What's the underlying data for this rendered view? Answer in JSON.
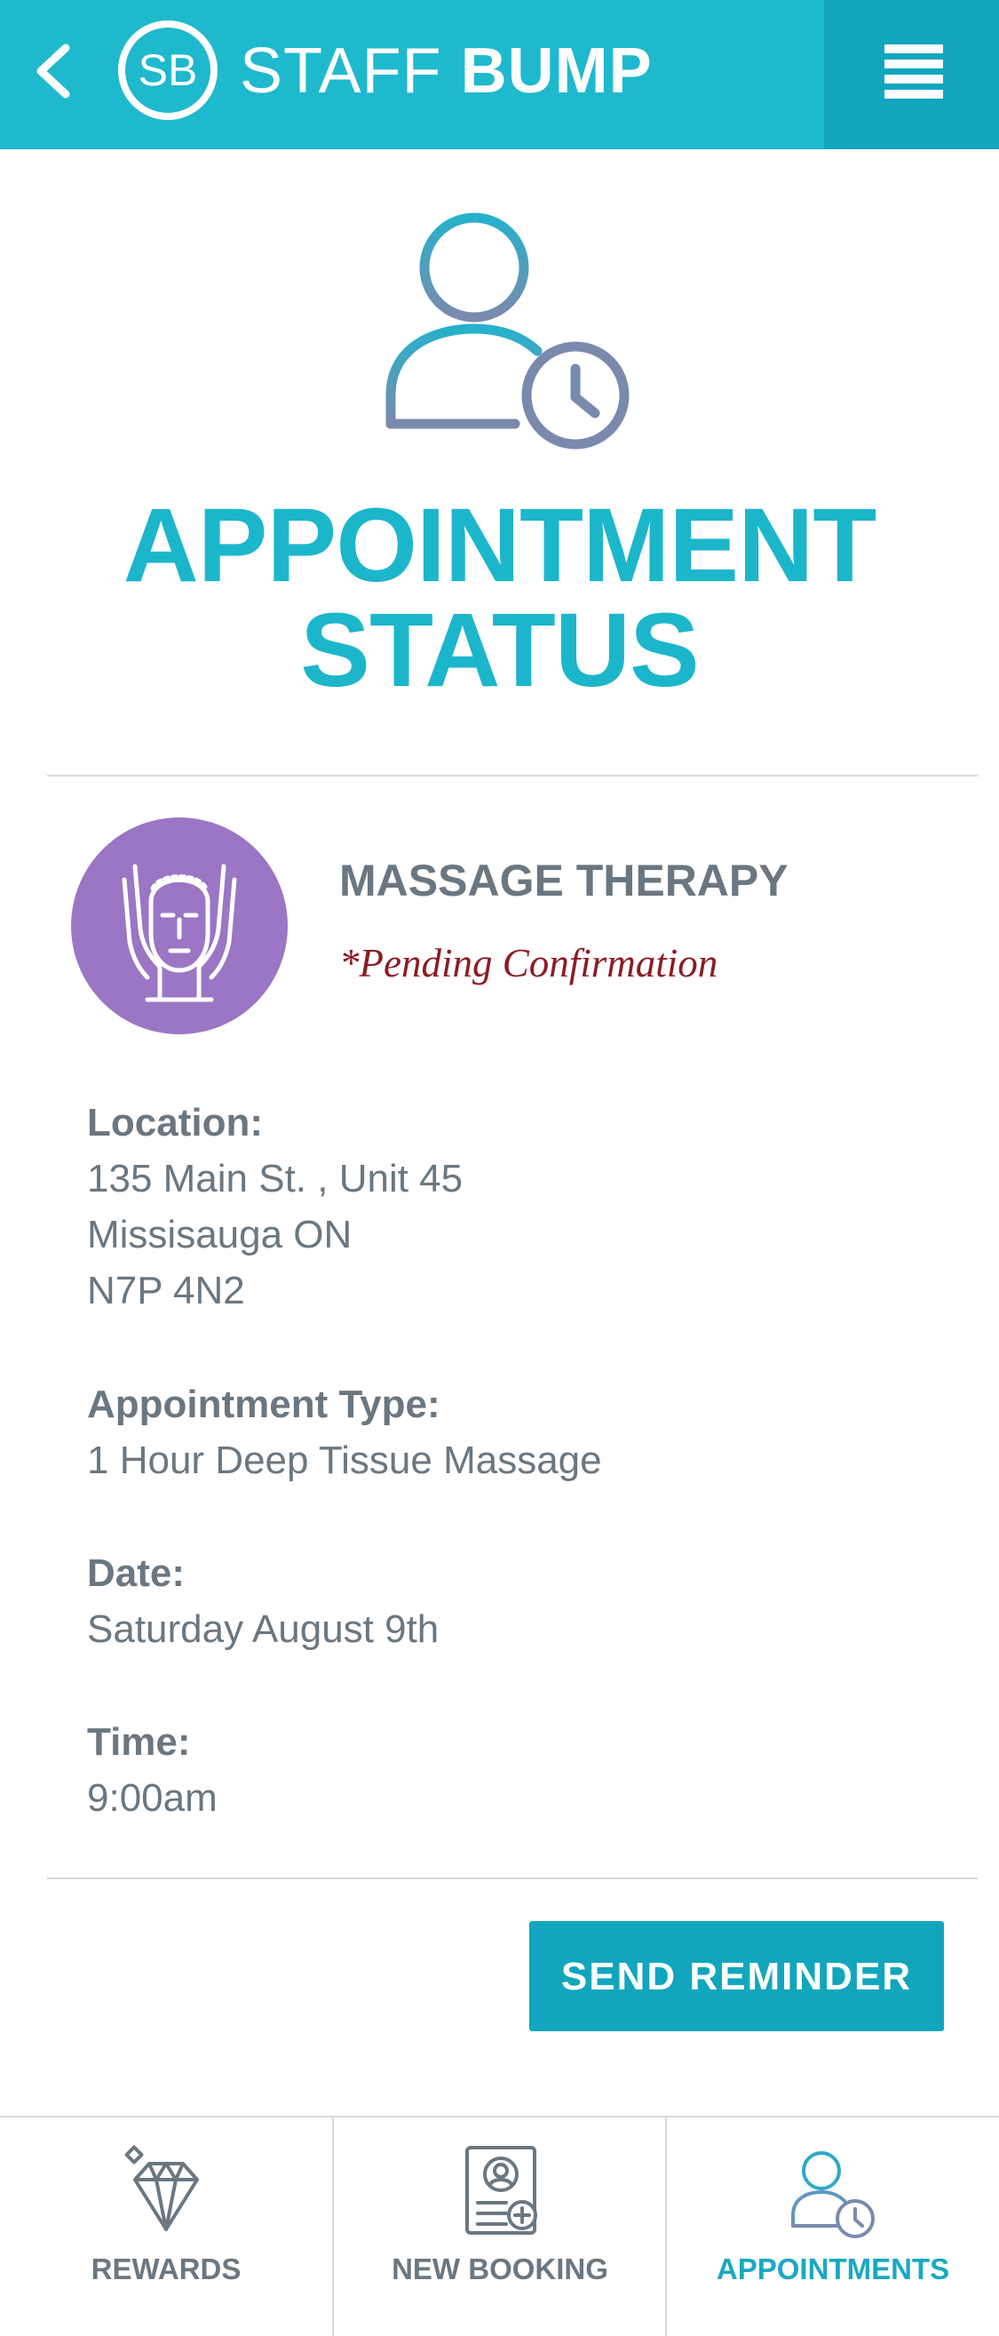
{
  "header": {
    "logo_text": "SB",
    "brand_light": "STAFF",
    "brand_bold": "BUMP"
  },
  "page": {
    "title_line1": "APPOINTMENT",
    "title_line2": "STATUS"
  },
  "service": {
    "name": "MASSAGE THERAPY",
    "status": "*Pending Confirmation",
    "icon": "massage-face-icon"
  },
  "details": {
    "location_label": "Location:",
    "location_line1": "135 Main St. , Unit 45",
    "location_line2": "Missisauga ON",
    "location_line3": "N7P 4N2",
    "type_label": "Appointment Type:",
    "type_value": "1 Hour Deep Tissue Massage",
    "date_label": "Date:",
    "date_value": "Saturday August 9th",
    "time_label": "Time:",
    "time_value": "9:00am"
  },
  "actions": {
    "send_reminder": "SEND REMINDER"
  },
  "bottom_nav": {
    "items": [
      {
        "label": "REWARDS",
        "icon": "diamond-icon",
        "active": false
      },
      {
        "label": "NEW BOOKING",
        "icon": "booking-add-icon",
        "active": false
      },
      {
        "label": "APPOINTMENTS",
        "icon": "user-clock-icon",
        "active": true
      }
    ]
  },
  "colors": {
    "brand": "#1fb9cd",
    "brand_dark": "#11a6bd",
    "text": "#6b7780",
    "pending": "#8c1c24",
    "service_icon_bg": "#9a76c4"
  }
}
